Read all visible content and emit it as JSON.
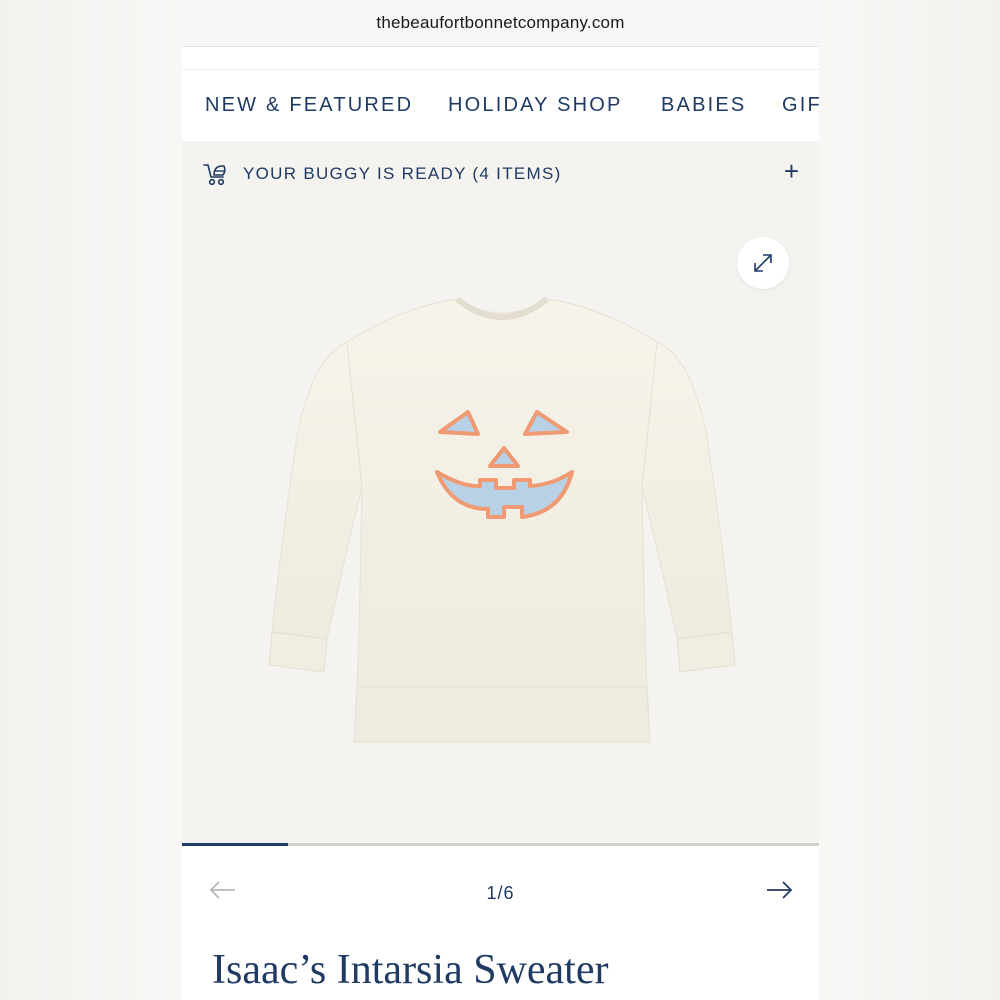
{
  "browser": {
    "url": "thebeaufortbonnetcompany.com"
  },
  "nav": {
    "items": [
      {
        "label": "NEW & FEATURED"
      },
      {
        "label": "HOLIDAY SHOP"
      },
      {
        "label": "BABIES"
      },
      {
        "label": "GIF"
      }
    ]
  },
  "buggy": {
    "text": "YOUR BUGGY IS READY (4 ITEMS)",
    "icon": "stroller-icon",
    "plus": "+"
  },
  "gallery": {
    "expand_icon": "expand-arrows-icon",
    "image_subject": "cream sweater with jack-o'-lantern face",
    "progress_fraction": 0.1667,
    "counter": "1/6"
  },
  "product": {
    "title": "Isaac’s Intarsia Sweater"
  },
  "colors": {
    "brand_navy": "#1f3a63",
    "page_bg": "#f4f3f0",
    "sweater_cream": "#f3efe4",
    "face_blue": "#b9d1e6",
    "face_orange": "#ef9a73"
  }
}
